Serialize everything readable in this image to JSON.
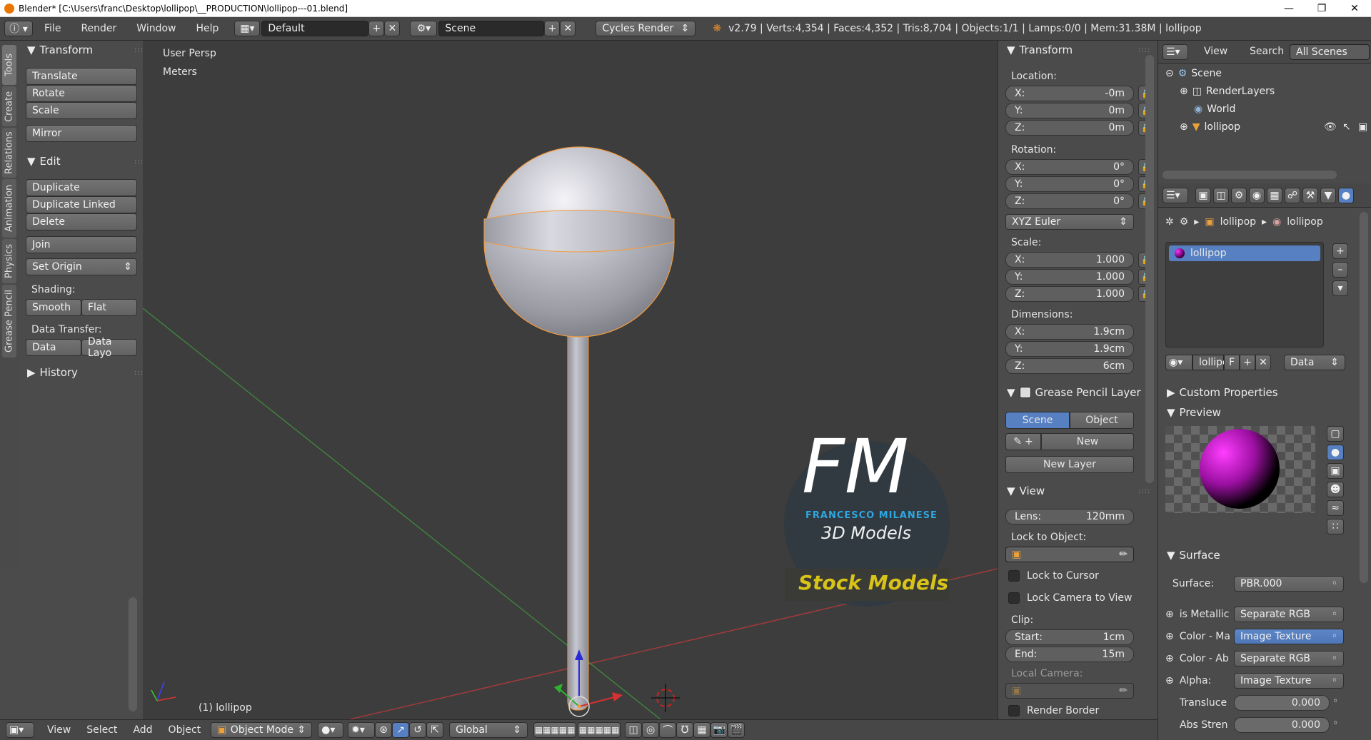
{
  "window": {
    "title": "Blender* [C:\\Users\\franc\\Desktop\\lollipop\\__PRODUCTION\\lollipop---01.blend]"
  },
  "menu": {
    "items": [
      "File",
      "Render",
      "Window",
      "Help"
    ],
    "layout": "Default",
    "scene": "Scene",
    "engine": "Cycles Render",
    "stats": "v2.79 | Verts:4,354 | Faces:4,352 | Tris:8,704 | Objects:1/1 | Lamps:0/0 | Mem:31.38M | lollipop"
  },
  "tabs": [
    "Tools",
    "Create",
    "Relations",
    "Animation",
    "Physics",
    "Grease Pencil"
  ],
  "tools": {
    "transform_header": "Transform",
    "translate": "Translate",
    "rotate": "Rotate",
    "scale": "Scale",
    "mirror": "Mirror",
    "edit_header": "Edit",
    "duplicate": "Duplicate",
    "duplicate_linked": "Duplicate Linked",
    "delete": "Delete",
    "join": "Join",
    "set_origin": "Set Origin",
    "shading_label": "Shading:",
    "smooth": "Smooth",
    "flat": "Flat",
    "data_transfer_label": "Data Transfer:",
    "data": "Data",
    "data_layo": "Data Layo",
    "history_header": "History"
  },
  "viewport": {
    "view_name": "User Persp",
    "units": "Meters",
    "object_label": "(1) lollipop",
    "watermark_fm": "FM",
    "watermark_name": "FRANCESCO MILANESE",
    "watermark_sub": "3D Models",
    "watermark_stock": "Stock Models",
    "colors": {
      "background": "#3d3d3d",
      "x_axis": "#b53a3a",
      "y_axis": "#3c9a3c",
      "selection": "#f39c3f"
    }
  },
  "n_panel": {
    "transform_header": "Transform",
    "location_label": "Location:",
    "loc_x": "-0m",
    "loc_y": "0m",
    "loc_z": "0m",
    "rotation_label": "Rotation:",
    "rot_x": "0°",
    "rot_y": "0°",
    "rot_z": "0°",
    "rot_mode": "XYZ Euler",
    "scale_label": "Scale:",
    "scale_x": "1.000",
    "scale_y": "1.000",
    "scale_z": "1.000",
    "dimensions_label": "Dimensions:",
    "dim_x": "1.9cm",
    "dim_y": "1.9cm",
    "dim_z": "6cm",
    "axis_x": "X:",
    "axis_y": "Y:",
    "axis_z": "Z:",
    "gp_header": "Grease Pencil Layer",
    "gp_scene": "Scene",
    "gp_object": "Object",
    "gp_new": "New",
    "gp_new_layer": "New Layer",
    "view_header": "View",
    "lens_label": "Lens:",
    "lens_value": "120mm",
    "lock_to_object": "Lock to Object:",
    "lock_to_cursor": "Lock to Cursor",
    "lock_camera": "Lock Camera to View",
    "clip_label": "Clip:",
    "clip_start_label": "Start:",
    "clip_start": "1cm",
    "clip_end_label": "End:",
    "clip_end": "15m",
    "local_camera": "Local Camera:",
    "render_border": "Render Border"
  },
  "outliner": {
    "view": "View",
    "search": "Search",
    "filter": "All Scenes",
    "scene": "Scene",
    "render_layers": "RenderLayers",
    "world": "World",
    "object": "lollipop"
  },
  "properties": {
    "breadcrumb_obj": "lollipop",
    "breadcrumb_mat": "lollipop",
    "material_slot": "lollipop",
    "mat_name": "lollipo",
    "mat_f": "F",
    "link": "Data",
    "custom_props": "Custom Properties",
    "preview": "Preview",
    "surface_header": "Surface",
    "surface_label": "Surface:",
    "surface_value": "PBR.000",
    "inputs": [
      {
        "label": "is Metallic",
        "value": "Separate RGB"
      },
      {
        "label": "Color - Ma",
        "value": "Image Texture"
      },
      {
        "label": "Color - Ab",
        "value": "Separate RGB"
      },
      {
        "label": "Alpha:",
        "value": "Image Texture"
      }
    ],
    "translucent_label": "Transluce",
    "translucent_value": "0.000",
    "abs_label": "Abs Stren",
    "abs_value": "0.000"
  },
  "bottom": {
    "view": "View",
    "select": "Select",
    "add": "Add",
    "object": "Object",
    "mode": "Object Mode",
    "orientation": "Global"
  }
}
